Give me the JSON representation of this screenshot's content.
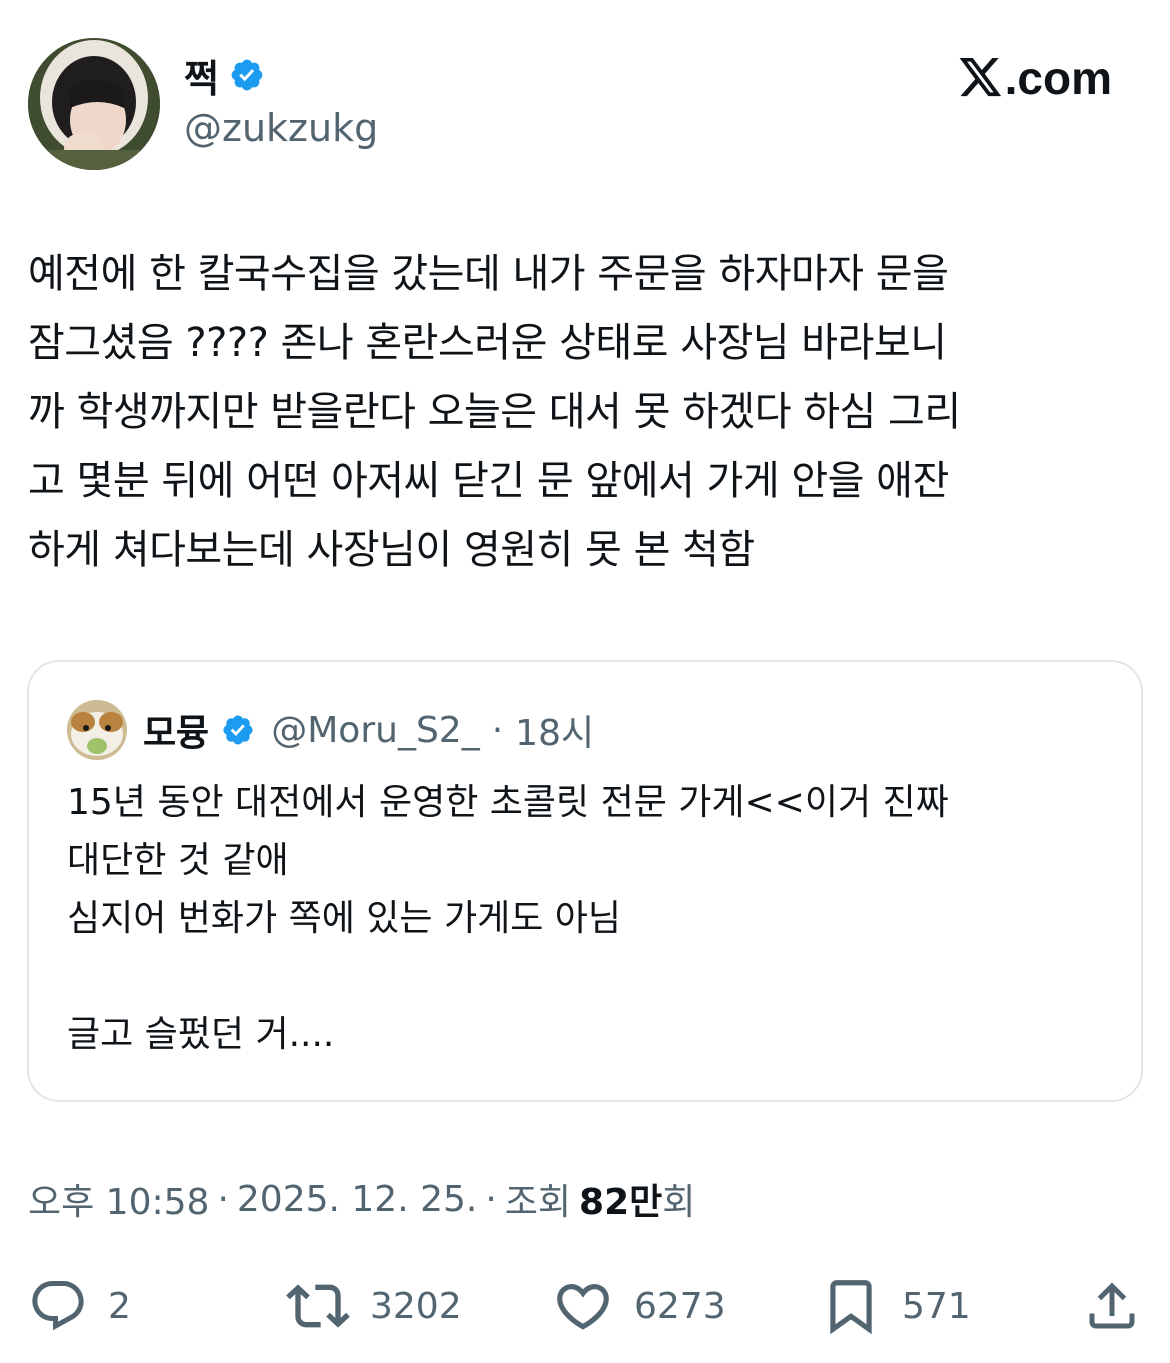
{
  "author": {
    "display_name": "쩍",
    "handle": "@zukzukg",
    "verified": true,
    "avatar_icon": "profile-photo"
  },
  "brand": {
    "label": ".com",
    "logo_icon": "x-logo-icon"
  },
  "tweet": {
    "lines": [
      "예전에 한 칼국수집을 갔는데 내가 주문을 하자마자 문을",
      "잠그셨음 ???? 존나 혼란스러운 상태로 사장님 바라보니",
      "까 학생까지만 받을란다 오늘은 대서 못 하겠다 하심 그리",
      "고 몇분 뒤에 어떤 아저씨 닫긴 문 앞에서 가게 안을 애잔",
      "하게 쳐다보는데 사장님이 영원히 못 본 척함"
    ]
  },
  "quoted_tweet": {
    "display_name": "모뮹",
    "handle": "@Moru_S2_",
    "separator": "·",
    "time": "18시",
    "verified": true,
    "avatar_icon": "guinea-pig-photo",
    "lines": [
      "15년 동안 대전에서 운영한 초콜릿 전문 가게<<이거 진짜",
      "대단한 것 같애",
      "심지어 번화가 쪽에 있는 가게도 아님",
      "",
      "글고 슬펐던 거...."
    ]
  },
  "meta": {
    "time": "오후 10:58",
    "date": "2025. 12. 25.",
    "sep": "·",
    "views_label": "조회",
    "views_count": "82만",
    "views_suffix": "회"
  },
  "actions": {
    "replies": "2",
    "reposts": "3202",
    "likes": "6273",
    "bookmarks": "571"
  },
  "colors": {
    "text": "#0f1419",
    "secondary": "#536471",
    "verified": "#1d9bf0",
    "border": "#e1e6ea"
  }
}
